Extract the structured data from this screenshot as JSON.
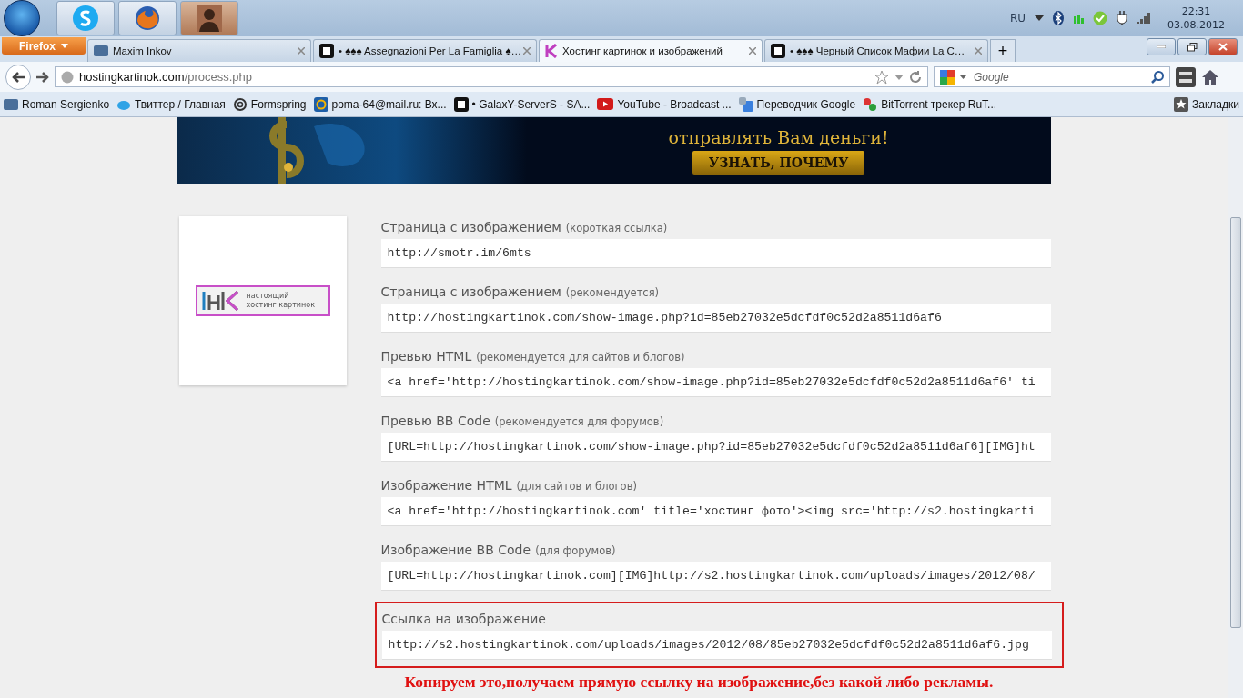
{
  "taskbar": {
    "tray": {
      "language": "RU",
      "time": "22:31",
      "date": "03.08.2012"
    }
  },
  "browser": {
    "menu_button": "Firefox",
    "tabs": [
      {
        "title": "Maxim Inkov",
        "kind": "vk",
        "selected": false
      },
      {
        "title": "• ♠♠♠ Assegnazioni Per La Famiglia ♠…",
        "kind": "g",
        "selected": false
      },
      {
        "title": "Хостинг картинок и изображений",
        "kind": "k",
        "selected": true
      },
      {
        "title": "• ♠♠♠ Черный Список Мафии La C…",
        "kind": "g",
        "selected": false
      }
    ],
    "new_tab": "+",
    "address": {
      "host": "hostingkartinok.com",
      "path": "/process.php"
    },
    "search": {
      "placeholder": "Google"
    },
    "bookmarks": [
      {
        "label": "Roman Sergienko",
        "kind": "vk"
      },
      {
        "label": "Твиттер / Главная",
        "kind": "bird"
      },
      {
        "label": "Formspring",
        "kind": "spring"
      },
      {
        "label": "poma-64@mail.ru: Вх...",
        "kind": "at"
      },
      {
        "label": "• GalaxY-ServerS - SA...",
        "kind": "g"
      },
      {
        "label": "YouTube - Broadcast ...",
        "kind": "yt"
      },
      {
        "label": "Переводчик Google",
        "kind": "translate"
      },
      {
        "label": "BitTorrent трекер RuT...",
        "kind": "torrent"
      }
    ],
    "bookmarks_menu": "Закладки"
  },
  "banner": {
    "headline": "отправлять Вам деньги!",
    "button": "УЗНАТЬ, ПОЧЕМУ"
  },
  "logo": {
    "line_1": "настоящий",
    "line_2": "хостинг картинок"
  },
  "fields": [
    {
      "label": "Страница с изображением",
      "hint": "(короткая ссылка)",
      "value": "http://smotr.im/6mts",
      "highlighted": false
    },
    {
      "label": "Страница с изображением",
      "hint": "(рекомендуется)",
      "value": "http://hostingkartinok.com/show-image.php?id=85eb27032e5dcfdf0c52d2a8511d6af6",
      "highlighted": false
    },
    {
      "label": "Превью HTML",
      "hint": "(рекомендуется для сайтов и блогов)",
      "value": "<a href='http://hostingkartinok.com/show-image.php?id=85eb27032e5dcfdf0c52d2a8511d6af6' ti",
      "highlighted": false
    },
    {
      "label": "Превью BB Code",
      "hint": "(рекомендуется для форумов)",
      "value": "[URL=http://hostingkartinok.com/show-image.php?id=85eb27032e5dcfdf0c52d2a8511d6af6][IMG]ht",
      "highlighted": false
    },
    {
      "label": "Изображение HTML",
      "hint": "(для сайтов и блогов)",
      "value": "<a href='http://hostingkartinok.com' title='хостинг фото'><img src='http://s2.hostingkarti",
      "highlighted": false
    },
    {
      "label": "Изображение BB Code",
      "hint": "(для форумов)",
      "value": "[URL=http://hostingkartinok.com][IMG]http://s2.hostingkartinok.com/uploads/images/2012/08/",
      "highlighted": false
    },
    {
      "label": "Ссылка на изображение",
      "value": "http://s2.hostingkartinok.com/uploads/images/2012/08/85eb27032e5dcfdf0c52d2a8511d6af6.jpg",
      "highlighted": true
    }
  ],
  "annotation": "Копируем это,получаем прямую ссылку на изображение,без какой либо рекламы."
}
